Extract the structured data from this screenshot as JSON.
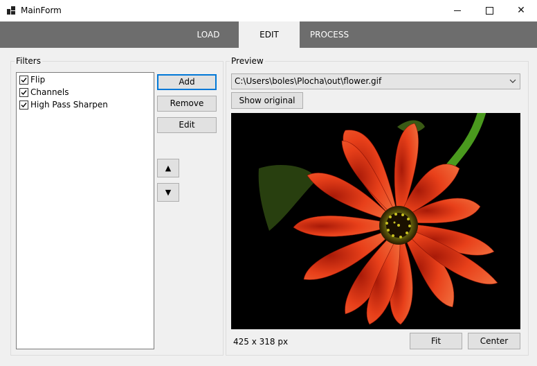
{
  "window": {
    "title": "MainForm",
    "controls": {
      "minimize": "minimize",
      "maximize": "maximize",
      "close": "✕"
    }
  },
  "tabs": [
    {
      "label": "LOAD",
      "active": false
    },
    {
      "label": "EDIT",
      "active": true
    },
    {
      "label": "PROCESS",
      "active": false
    }
  ],
  "filters": {
    "group_label": "Filters",
    "items": [
      {
        "label": "Flip",
        "checked": true
      },
      {
        "label": "Channels",
        "checked": true
      },
      {
        "label": "High Pass Sharpen",
        "checked": true
      }
    ],
    "buttons": {
      "add": "Add",
      "remove": "Remove",
      "edit": "Edit",
      "up": "▲",
      "down": "▼"
    }
  },
  "preview": {
    "group_label": "Preview",
    "path": "C:\\Users\\boles\\Plocha\\out\\flower.gif",
    "show_original": "Show original",
    "image_subject": "red gerbera flower on black background",
    "size_text": "425 x 318 px",
    "fit": "Fit",
    "center": "Center"
  },
  "colors": {
    "tabbar": "#6d6d6d",
    "accent": "#0078d7",
    "petal": "#e8401a",
    "stem": "#4a9a1e"
  }
}
